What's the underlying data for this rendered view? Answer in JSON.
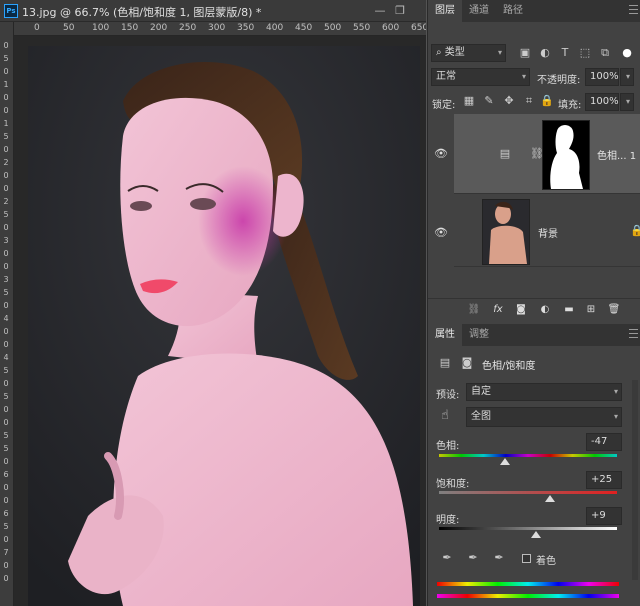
{
  "document": {
    "title": "13.jpg @ 66.7% (色相/饱和度 1, 图层蒙版/8) *",
    "logo": "Ps",
    "window_buttons": [
      "—",
      "❐"
    ]
  },
  "ruler": {
    "top_ticks": [
      "0",
      "50",
      "100",
      "150",
      "200",
      "250",
      "300",
      "350",
      "400",
      "450",
      "500",
      "550",
      "600",
      "650"
    ],
    "left_ticks": [
      "0",
      "5",
      "0",
      "1",
      "0",
      "0",
      "1",
      "5",
      "0",
      "2",
      "0",
      "0",
      "2",
      "5",
      "0",
      "3",
      "0",
      "0",
      "3",
      "5",
      "0",
      "4",
      "0",
      "0",
      "4",
      "5",
      "0",
      "5",
      "0",
      "0",
      "5",
      "5",
      "0",
      "6",
      "0",
      "0",
      "6",
      "5",
      "0",
      "7",
      "0",
      "0"
    ]
  },
  "layers_panel": {
    "tabs": [
      "图层",
      "通道",
      "路径"
    ],
    "active_tab": "图层",
    "filter_label": "类型",
    "blend_mode": "正常",
    "opacity_label": "不透明度:",
    "opacity_value": "100%",
    "lock_label": "锁定:",
    "fill_label": "填充:",
    "fill_value": "100%",
    "layers": [
      {
        "name": "色相... 1",
        "visible": true,
        "type": "adjustment"
      },
      {
        "name": "背景",
        "visible": true,
        "type": "background",
        "locked": true
      }
    ],
    "bottom_icons": [
      "link-icon",
      "fx-icon",
      "mask-icon",
      "adjustment-icon",
      "folder-icon",
      "new-layer-icon",
      "trash-icon"
    ]
  },
  "properties_panel": {
    "tabs": [
      "属性",
      "调整"
    ],
    "active_tab": "属性",
    "title": "色相/饱和度",
    "preset_label": "预设:",
    "preset_value": "自定",
    "range_value": "全图",
    "hue_label": "色相:",
    "hue_value": "-47",
    "saturation_label": "饱和度:",
    "saturation_value": "+25",
    "lightness_label": "明度:",
    "lightness_value": "+9",
    "colorize_label": "着色",
    "colorize_checked": false,
    "hue_level": -47,
    "saturation_level": 25,
    "lightness_level": 9
  }
}
